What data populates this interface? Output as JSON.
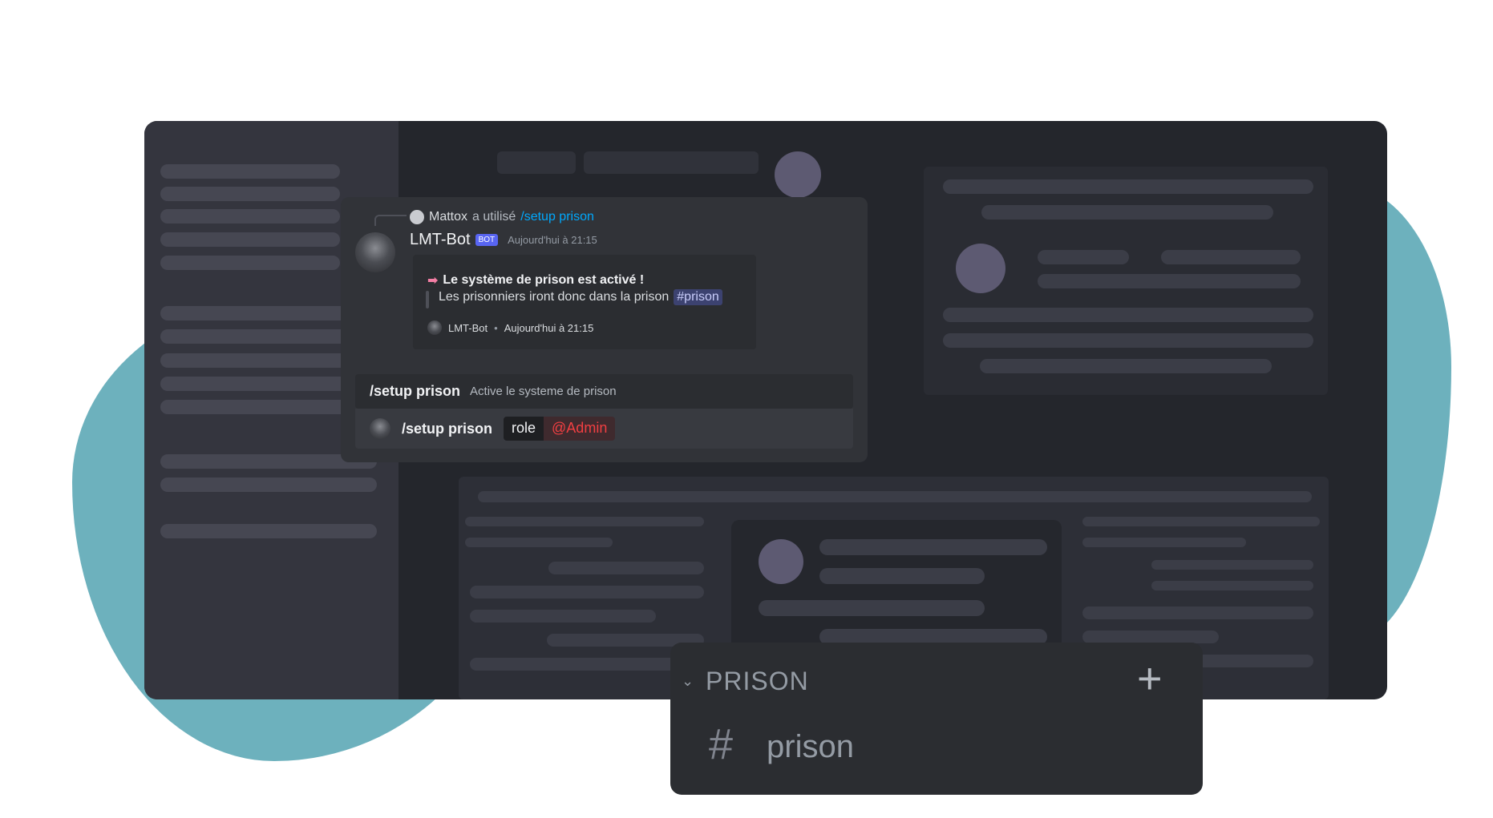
{
  "chat": {
    "reply": {
      "user": "Mattox",
      "used_text": "a utilisé",
      "command": "/setup prison"
    },
    "message": {
      "author": "LMT-Bot",
      "badge": "BOT",
      "timestamp": "Aujourd'hui à 21:15"
    },
    "embed": {
      "arrow": "➡",
      "title": "Le système de prison est activé !",
      "description": "Les prisonniers iront donc dans la prison",
      "channel_mention": "#prison",
      "footer_author": "LMT-Bot",
      "footer_separator": "•",
      "footer_time": "Aujourd'hui à 21:15"
    },
    "command_suggestion": {
      "name": "/setup prison",
      "description": "Active le systeme de prison"
    },
    "input": {
      "command": "/setup prison",
      "option_name": "role",
      "option_value": "@Admin"
    }
  },
  "category": {
    "chevron": "⌄",
    "name": "PRISON",
    "add": "+",
    "channel_hash": "#",
    "channel_name": "prison"
  },
  "colors": {
    "blob": "#6db1bd",
    "window_bg": "#24262c",
    "sidebar_bg": "#34353e",
    "bot_badge": "#5865f2",
    "mention_bg": "#3c4270",
    "role_mention": "#f23f42",
    "link": "#00a8fc"
  },
  "icons": [
    "user-avatar-icon",
    "bot-avatar-icon",
    "chevron-down-icon",
    "plus-icon",
    "hash-icon",
    "arrow-right-icon"
  ]
}
